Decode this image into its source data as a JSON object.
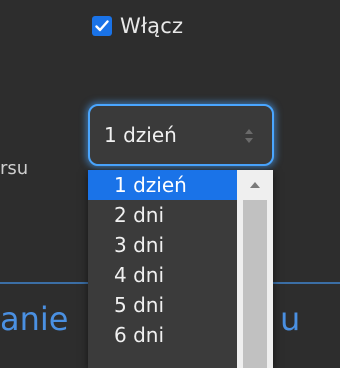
{
  "enable": {
    "label": "Włącz",
    "checked": true
  },
  "side_label": "rsu",
  "select": {
    "value": "1 dzień"
  },
  "dropdown": {
    "options": [
      "1 dzień",
      "2 dni",
      "3 dni",
      "4 dni",
      "5 dni",
      "6 dni"
    ],
    "selected_index": 0
  },
  "background_link": {
    "left_text": "anie",
    "right_text": "u"
  },
  "colors": {
    "accent": "#1a73e8",
    "focus_ring": "#4aa6ff",
    "link": "#4a90e2",
    "background": "#2d2d2d"
  }
}
